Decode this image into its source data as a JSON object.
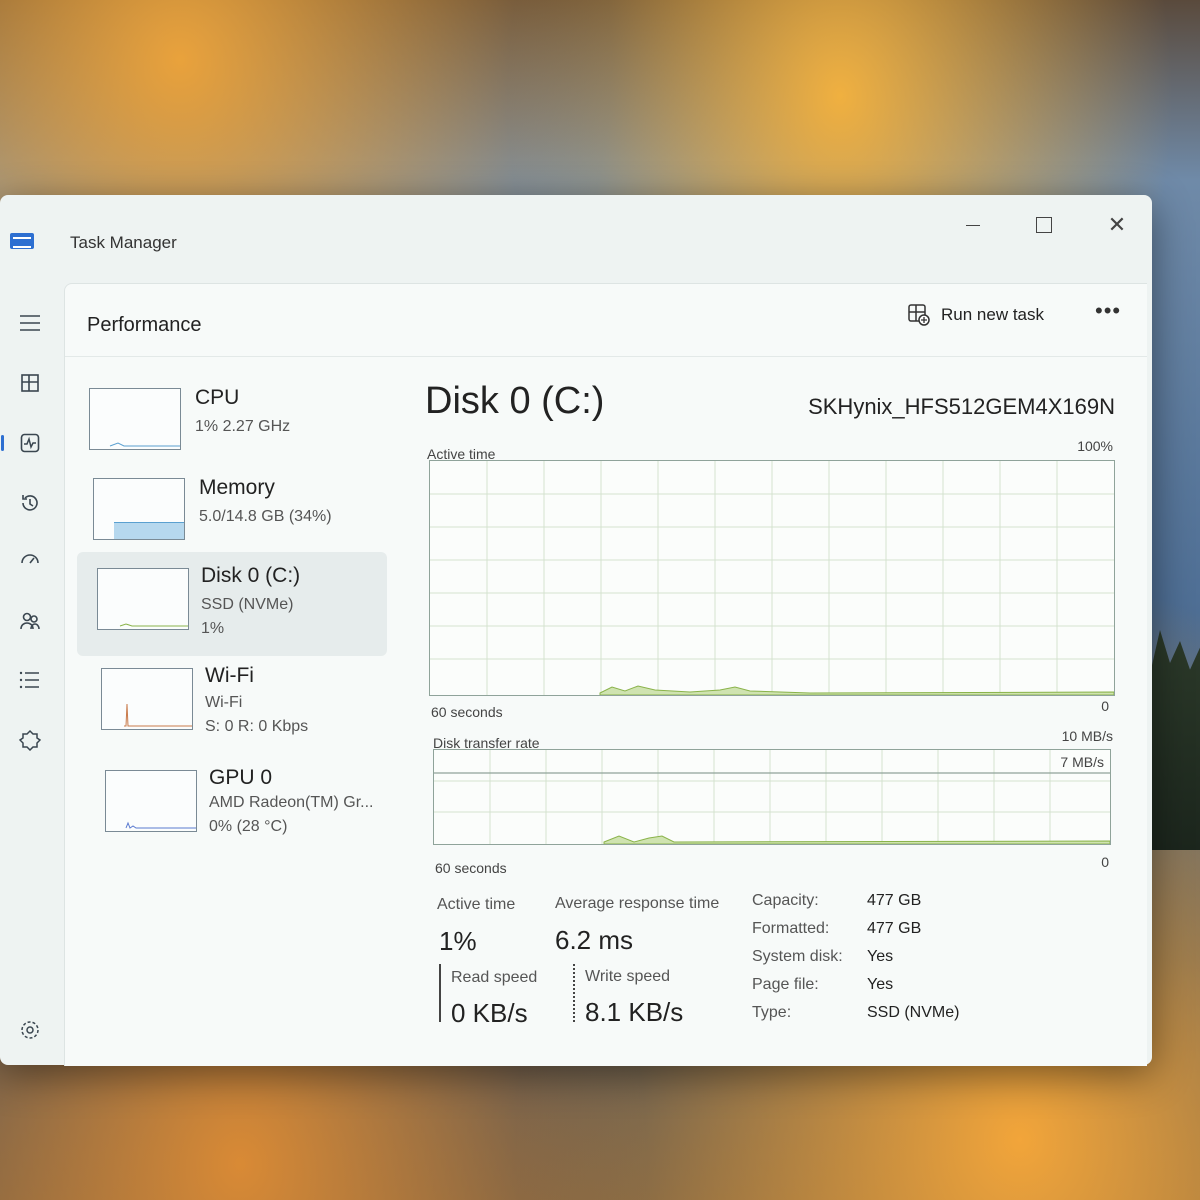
{
  "window": {
    "title": "Task Manager"
  },
  "header": {
    "page_title": "Performance",
    "run_task_label": "Run new task",
    "more_label": "•••"
  },
  "sidebar": [
    {
      "name": "CPU",
      "line1": "1% 2.27 GHz",
      "line2": ""
    },
    {
      "name": "Memory",
      "line1": "5.0/14.8 GB (34%)",
      "line2": ""
    },
    {
      "name": "Disk 0 (C:)",
      "line1": "SSD (NVMe)",
      "line2": "1%"
    },
    {
      "name": "Wi-Fi",
      "line1": "Wi-Fi",
      "line2": "S: 0 R: 0 Kbps"
    },
    {
      "name": "GPU 0",
      "line1": "AMD Radeon(TM) Gr...",
      "line2": "0% (28 °C)"
    }
  ],
  "detail": {
    "title": "Disk 0 (C:)",
    "model": "SKHynix_HFS512GEM4X169N",
    "active_graph": {
      "label": "Active time",
      "max": "100%",
      "time": "60 seconds",
      "min": "0"
    },
    "transfer_graph": {
      "label": "Disk transfer rate",
      "max": "10 MB/s",
      "mid": "7 MB/s",
      "time": "60 seconds",
      "min": "0"
    },
    "stats": {
      "active_time_label": "Active time",
      "active_time": "1%",
      "avg_resp_label": "Average response time",
      "avg_resp": "6.2 ms",
      "read_label": "Read speed",
      "read": "0 KB/s",
      "write_label": "Write speed",
      "write": "8.1 KB/s"
    },
    "props": [
      {
        "k": "Capacity:",
        "v": "477 GB"
      },
      {
        "k": "Formatted:",
        "v": "477 GB"
      },
      {
        "k": "System disk:",
        "v": "Yes"
      },
      {
        "k": "Page file:",
        "v": "Yes"
      },
      {
        "k": "Type:",
        "v": "SSD (NVMe)"
      }
    ]
  },
  "colors": {
    "accent": "#2d6fd1",
    "disk_line": "#8ab34a",
    "memory_fill": "#b6d8ee"
  }
}
